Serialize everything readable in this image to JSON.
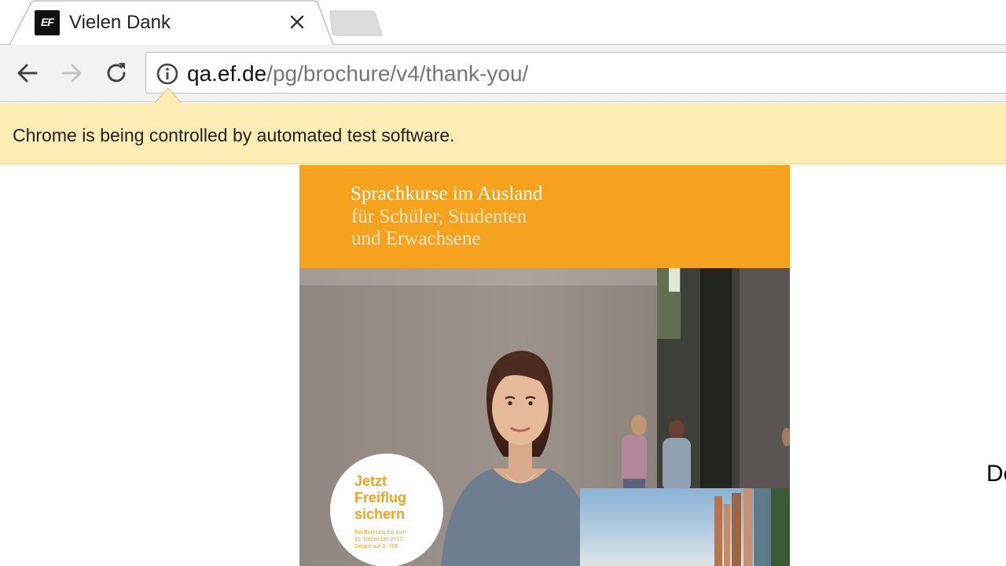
{
  "tab": {
    "favicon_text": "EF",
    "title": "Vielen Dank"
  },
  "toolbar": {
    "url_host": "qa.ef.de",
    "url_path": "/pg/brochure/v4/thank-you/"
  },
  "infobar": {
    "message": "Chrome is being controlled by automated test software."
  },
  "brochure": {
    "title": "Sprachkurse im Ausland",
    "subtitle_line1": "für Schüler, Studenten",
    "subtitle_line2": "und Erwachsene",
    "badge": {
      "line1": "Jetzt",
      "line2": "Freiflug",
      "line3": "sichern",
      "small1": "Bei Buchung bis zum",
      "small2": "31. Dezember 2017.",
      "small3": "Details auf S. 108"
    }
  },
  "page": {
    "edge_text": "De"
  },
  "colors": {
    "brochure_orange": "#f5a21f",
    "infobar_yellow": "#feecb5",
    "toolbar_gray": "#f2f2f2"
  },
  "icons": [
    "ef-logo-icon",
    "close-icon",
    "new-tab-icon",
    "back-arrow-icon",
    "forward-arrow-icon",
    "reload-icon",
    "info-icon"
  ]
}
